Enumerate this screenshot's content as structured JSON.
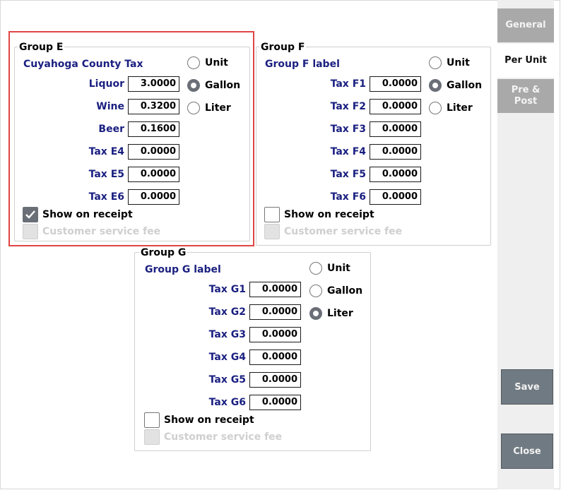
{
  "group_e": {
    "title": "Group E",
    "label": "Cuyahoga County Tax",
    "rows": [
      {
        "label": "Liquor",
        "value": "3.0000"
      },
      {
        "label": "Wine",
        "value": "0.3200"
      },
      {
        "label": "Beer",
        "value": "0.1600"
      },
      {
        "label": "Tax E4",
        "value": "0.0000"
      },
      {
        "label": "Tax E5",
        "value": "0.0000"
      },
      {
        "label": "Tax E6",
        "value": "0.0000"
      }
    ],
    "unit_options": [
      "Unit",
      "Gallon",
      "Liter"
    ],
    "selected_unit": "Gallon",
    "show_on_receipt": "Show on receipt",
    "customer_service_fee": "Customer service fee"
  },
  "group_f": {
    "title": "Group F",
    "label": "Group F label",
    "rows": [
      {
        "label": "Tax F1",
        "value": "0.0000"
      },
      {
        "label": "Tax F2",
        "value": "0.0000"
      },
      {
        "label": "Tax F3",
        "value": "0.0000"
      },
      {
        "label": "Tax F4",
        "value": "0.0000"
      },
      {
        "label": "Tax F5",
        "value": "0.0000"
      },
      {
        "label": "Tax F6",
        "value": "0.0000"
      }
    ],
    "unit_options": [
      "Unit",
      "Gallon",
      "Liter"
    ],
    "selected_unit": "Gallon",
    "show_on_receipt": "Show on receipt",
    "customer_service_fee": "Customer service fee"
  },
  "group_g": {
    "title": "Group G",
    "label": "Group G label",
    "rows": [
      {
        "label": "Tax G1",
        "value": "0.0000"
      },
      {
        "label": "Tax G2",
        "value": "0.0000"
      },
      {
        "label": "Tax G3",
        "value": "0.0000"
      },
      {
        "label": "Tax G4",
        "value": "0.0000"
      },
      {
        "label": "Tax G5",
        "value": "0.0000"
      },
      {
        "label": "Tax G6",
        "value": "0.0000"
      }
    ],
    "unit_options": [
      "Unit",
      "Gallon",
      "Liter"
    ],
    "selected_unit": "Liter",
    "show_on_receipt": "Show on receipt",
    "customer_service_fee": "Customer service fee"
  },
  "tabs": {
    "general": "General",
    "per_unit": "Per Unit",
    "pre_post": "Pre & Post"
  },
  "buttons": {
    "save": "Save",
    "close": "Close"
  },
  "colors": {
    "label_blue": "#1a1f80",
    "highlight_red": "#e04545",
    "button_grey": "#707a82"
  }
}
